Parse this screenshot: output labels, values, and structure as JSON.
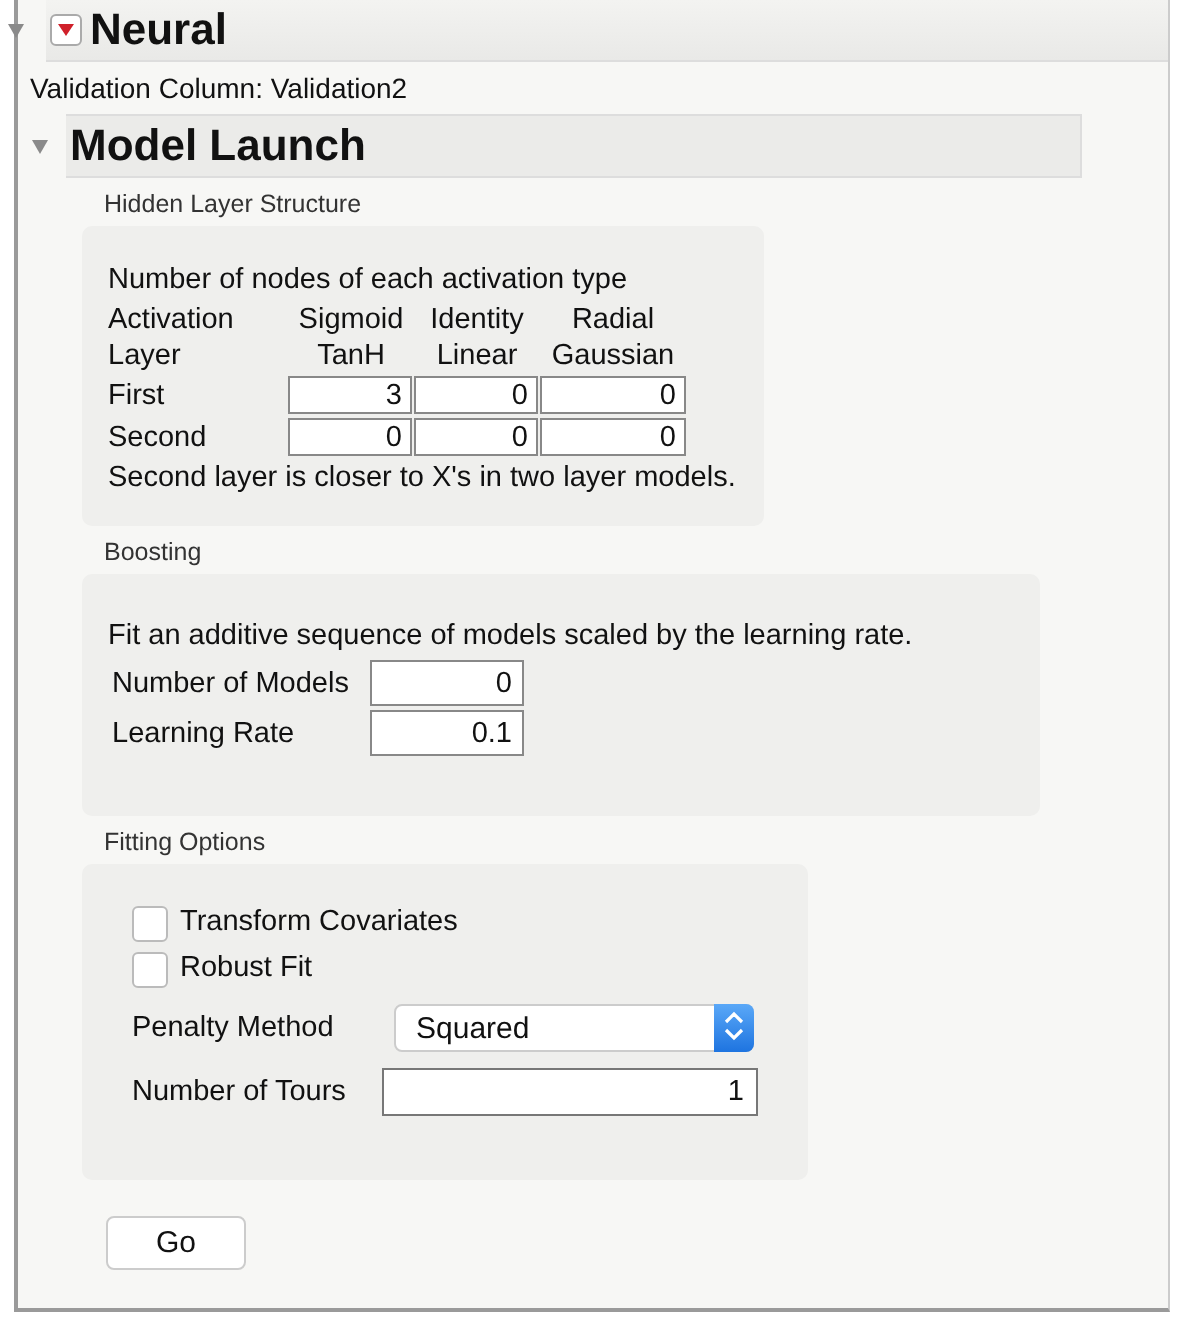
{
  "report": {
    "title": "Neural",
    "expanded": true
  },
  "validation_column": "Validation Column: Validation2",
  "model_launch": {
    "title": "Model Launch",
    "expanded": true
  },
  "hidden_layer": {
    "label": "Hidden Layer Structure",
    "intro": "Number of nodes of each activation type",
    "header_rows": [
      [
        "Activation",
        "Sigmoid",
        "Identity",
        "Radial"
      ],
      [
        "Layer",
        "TanH",
        "Linear",
        "Gaussian"
      ]
    ],
    "rows": [
      {
        "layer": "First",
        "values": [
          "3",
          "0",
          "0"
        ]
      },
      {
        "layer": "Second",
        "values": [
          "0",
          "0",
          "0"
        ]
      }
    ],
    "note": "Second layer is closer to X's in two layer models."
  },
  "boosting": {
    "label": "Boosting",
    "description": "Fit an additive sequence of models scaled by the learning rate.",
    "fields": [
      {
        "label": "Number of Models",
        "value": "0"
      },
      {
        "label": "Learning Rate",
        "value": "0.1"
      }
    ]
  },
  "fitting_options": {
    "label": "Fitting Options",
    "checkboxes": [
      {
        "label": "Transform Covariates",
        "checked": false
      },
      {
        "label": "Robust Fit",
        "checked": false
      }
    ],
    "penalty_method": {
      "label": "Penalty Method",
      "value": "Squared"
    },
    "number_of_tours": {
      "label": "Number of Tours",
      "value": "1"
    }
  },
  "buttons": [
    "Go"
  ]
}
